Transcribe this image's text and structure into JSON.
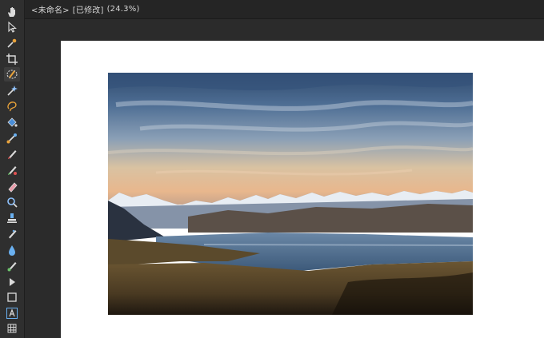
{
  "document": {
    "name": "<未命名>",
    "status": "[已修改]",
    "zoom": "(24.3%)"
  },
  "toolbar": {
    "tools": [
      {
        "id": "hand-icon",
        "active": false
      },
      {
        "id": "move-pointer-icon",
        "active": false
      },
      {
        "id": "color-picker-icon",
        "active": false
      },
      {
        "id": "crop-icon",
        "active": false
      },
      {
        "id": "selection-brush-icon",
        "active": true
      },
      {
        "id": "magic-wand-icon",
        "active": false
      },
      {
        "id": "freehand-selection-icon",
        "active": false
      },
      {
        "id": "flood-fill-icon",
        "active": false
      },
      {
        "id": "gradient-icon",
        "active": false
      },
      {
        "id": "paint-brush-icon",
        "active": false
      },
      {
        "id": "color-replacement-brush-icon",
        "active": false
      },
      {
        "id": "erase-brush-icon",
        "active": false
      },
      {
        "id": "dodge-icon",
        "active": false
      },
      {
        "id": "clone-stamp-icon",
        "active": false
      },
      {
        "id": "healing-brush-icon",
        "active": false
      },
      {
        "id": "blur-brush-icon",
        "active": false
      },
      {
        "id": "smudge-brush-icon",
        "active": false
      },
      {
        "id": "node-pointer-icon",
        "active": false
      },
      {
        "id": "rectangle-icon",
        "active": false
      },
      {
        "id": "artistic-text-icon",
        "active": false
      },
      {
        "id": "mesh-warp-icon",
        "active": false
      }
    ]
  },
  "colors": {
    "accent": "#e8a23a",
    "toolbar_bg": "#2f2f2f",
    "canvas_bg": "#2b2b2b",
    "page_bg": "#ffffff"
  }
}
